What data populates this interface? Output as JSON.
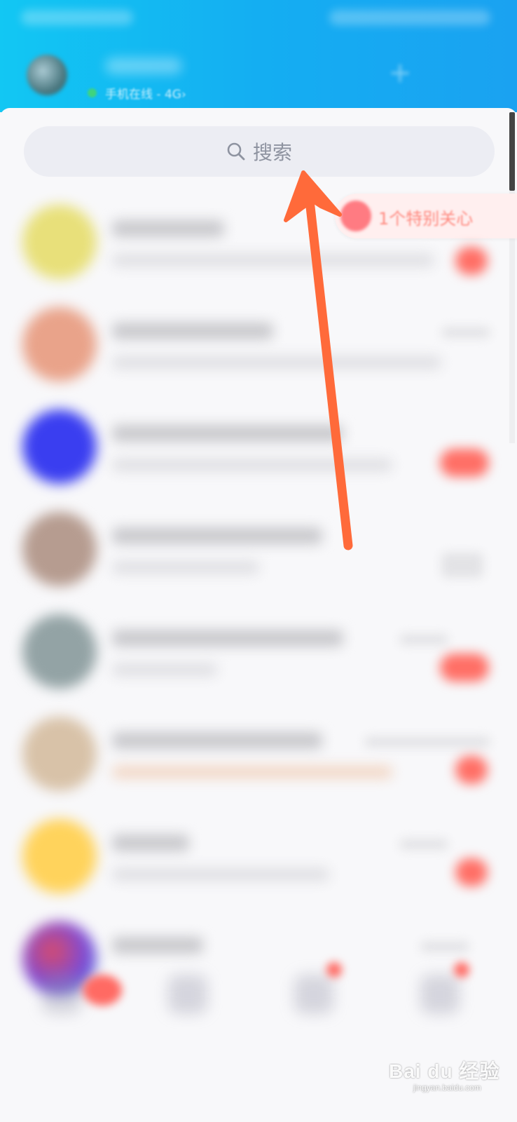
{
  "header": {
    "status_text": "手机在线 - 4G",
    "chevron": "›",
    "plus_icon": "plus-icon"
  },
  "search": {
    "label": "搜索",
    "icon": "search-icon"
  },
  "special_banner": {
    "text": "1个特别关心",
    "icon": "heart-icon"
  },
  "chat_list": [
    {
      "avatar_color": "#e8e07a",
      "badge": true
    },
    {
      "avatar_color": "#e9a38a",
      "badge": false
    },
    {
      "avatar_color": "#3a3ef0",
      "badge": true
    },
    {
      "avatar_color": "#b69c90",
      "badge": false
    },
    {
      "avatar_color": "#93a3a5",
      "badge": true
    },
    {
      "avatar_color": "#d8c2a8",
      "badge": true
    },
    {
      "avatar_color": "#ffd35c",
      "badge": true
    },
    {
      "avatar_color": "#9e6ad0",
      "badge": false
    }
  ],
  "annotation": {
    "arrow_color": "#ff6a3a"
  },
  "watermark": {
    "brand": "Bai du 经验",
    "url": "jingyan.baidu.com"
  }
}
